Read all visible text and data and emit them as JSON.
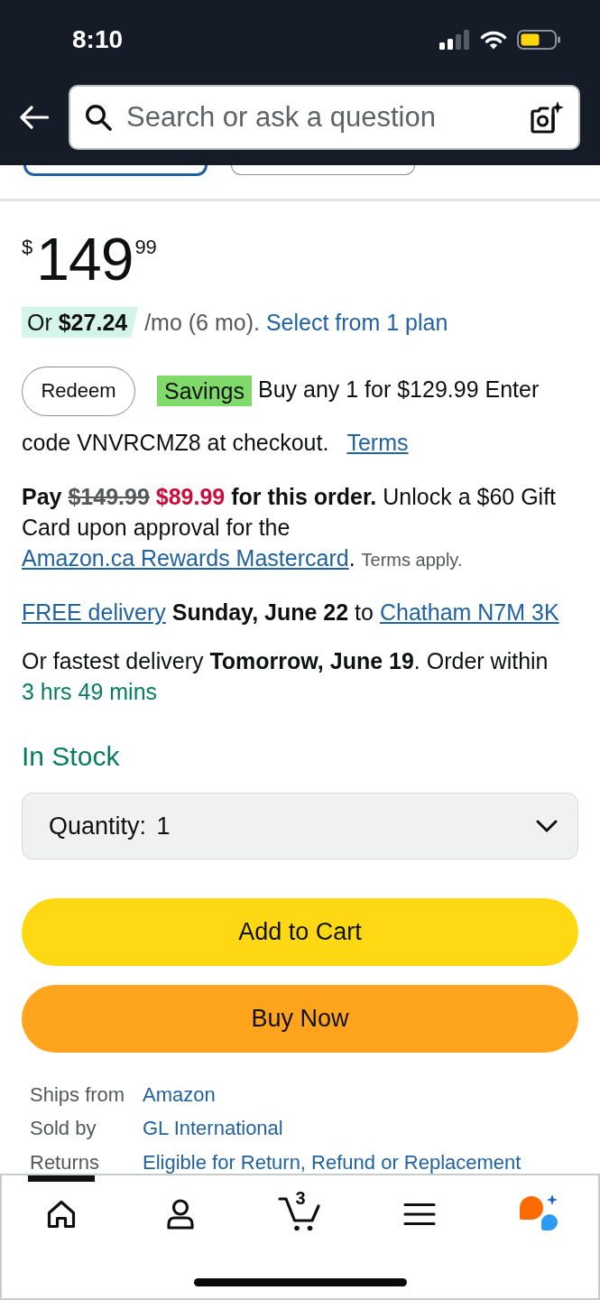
{
  "status_bar": {
    "time": "8:10"
  },
  "search": {
    "placeholder": "Search or ask a question"
  },
  "variant_options": [
    {
      "selected": true
    },
    {
      "selected": false
    }
  ],
  "price": {
    "currency": "$",
    "whole": "149",
    "fraction": "99"
  },
  "installment": {
    "highlight": "Or **$27.24**",
    "text": "/mo (6 mo).",
    "link": "Select from 1 plan"
  },
  "promotion": {
    "button": "Redeem",
    "badge": "Savings",
    "text": "Buy any 1 for $129.99 Enter code VNVRCMZ8 at checkout.",
    "link": "Terms"
  },
  "card_offer": [
    {
      "kind": "bold",
      "text": "Pay"
    },
    {
      "kind": "strike",
      "text": "$149.99"
    },
    {
      "kind": "deal",
      "text": "$89.99"
    },
    {
      "kind": "bold",
      "text": "for this order."
    },
    {
      "kind": "plain",
      "text": "Unlock a $60 Gift Card upon approval for the"
    },
    {
      "kind": "link",
      "text": "Amazon.ca Rewards Mastercard"
    },
    {
      "kind": "punct",
      "text": "."
    },
    {
      "kind": "note",
      "text": "Terms apply."
    }
  ],
  "delivery": [
    {
      "kind": "link",
      "text": "FREE delivery"
    },
    {
      "kind": "bold",
      "text": "Sunday, June 22"
    },
    {
      "kind": "plain",
      "text": "to"
    },
    {
      "kind": "link",
      "text": "Chatham N7M 3K"
    }
  ],
  "fastest_delivery": [
    {
      "kind": "plain",
      "text": "Or fastest delivery"
    },
    {
      "kind": "bold",
      "text": "Tomorrow, June 19"
    },
    {
      "kind": "punct",
      "text": ". Order within"
    },
    {
      "kind": "countdown",
      "text": "3 hrs 49 mins"
    }
  ],
  "stock": "In Stock",
  "quantity": {
    "label": "Quantity:",
    "value": "1"
  },
  "buttons": [
    {
      "kind": "cart",
      "label": "Add to Cart"
    },
    {
      "kind": "buy",
      "label": "Buy Now"
    }
  ],
  "details": [
    {
      "label": "Ships from",
      "value": "Amazon"
    },
    {
      "label": "Sold by",
      "value": "GL International"
    },
    {
      "label": "Returns",
      "value": "Eligible for Return, Refund or Replacement"
    }
  ],
  "bottom_nav": [
    {
      "kind": "home",
      "selected": true
    },
    {
      "kind": "account",
      "selected": false
    },
    {
      "kind": "cart",
      "selected": false,
      "badge": "3"
    },
    {
      "kind": "menu",
      "selected": false
    },
    {
      "kind": "assistant",
      "selected": false
    }
  ]
}
